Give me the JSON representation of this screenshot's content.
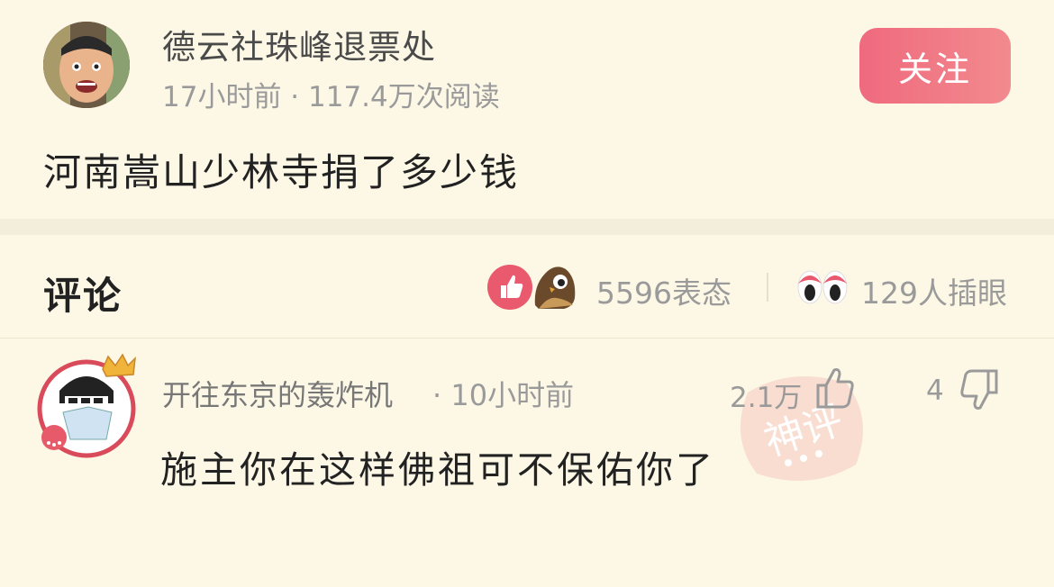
{
  "post": {
    "author": "德云社珠峰退票处",
    "meta": "17小时前 · 117.4万次阅读",
    "follow_label": "关注",
    "title": "河南嵩山少林寺捐了多少钱"
  },
  "comments_header": {
    "title": "评论",
    "reactions_count": "5596表态",
    "poke_count": "129人插眼"
  },
  "comment": {
    "author": "开往东京的轰炸机",
    "time": "· 10小时前",
    "likes": "2.1万",
    "dislikes": "4",
    "text": "施主你在这样佛祖可不保佑你了",
    "badge_text": "神评"
  },
  "colors": {
    "background": "#fdf8e6",
    "accent": "#ef6a7e",
    "muted_text": "#9a9a9a"
  }
}
